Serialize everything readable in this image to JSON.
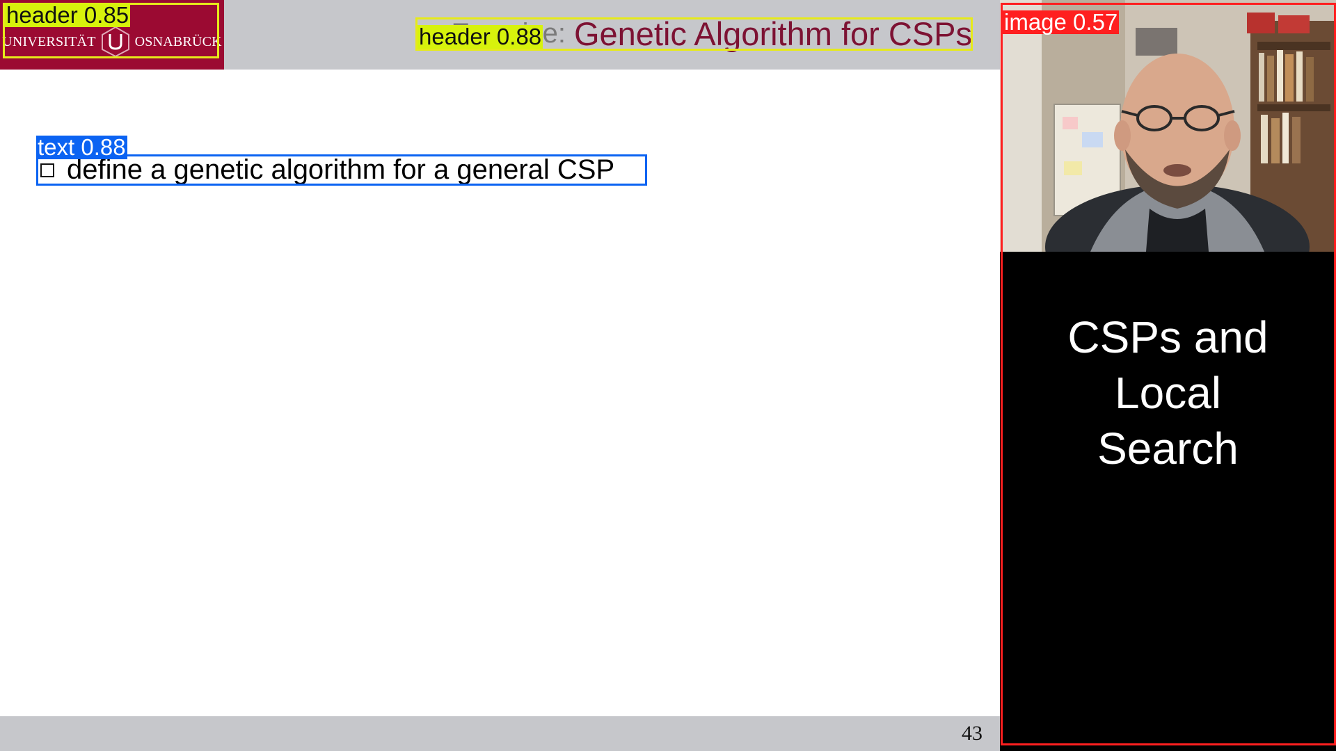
{
  "header": {
    "logo": {
      "left_text": "UNIVERSITÄT",
      "right_text": "OSNABRÜCK",
      "color": "#9b0a32"
    },
    "title_kicker": "Exercise:",
    "title": "Genetic Algorithm for CSPs"
  },
  "content": {
    "bullets": [
      {
        "text": "define a genetic algorithm for a general CSP"
      }
    ]
  },
  "footer": {
    "page_number": "43"
  },
  "side_panel": {
    "caption_lines": [
      "CSPs and",
      "Local",
      "Search"
    ]
  },
  "detections": [
    {
      "label": "header",
      "score": "0.85",
      "display": "header 0.85",
      "color": "#d7f20c"
    },
    {
      "label": "header",
      "score": "0.88",
      "display": "header 0.88",
      "color": "#d7f20c"
    },
    {
      "label": "text",
      "score": "0.88",
      "display": "text 0.88",
      "color": "#0b63f2"
    },
    {
      "label": "image",
      "score": "0.57",
      "display": "image 0.57",
      "color": "#ff1f1f"
    }
  ]
}
